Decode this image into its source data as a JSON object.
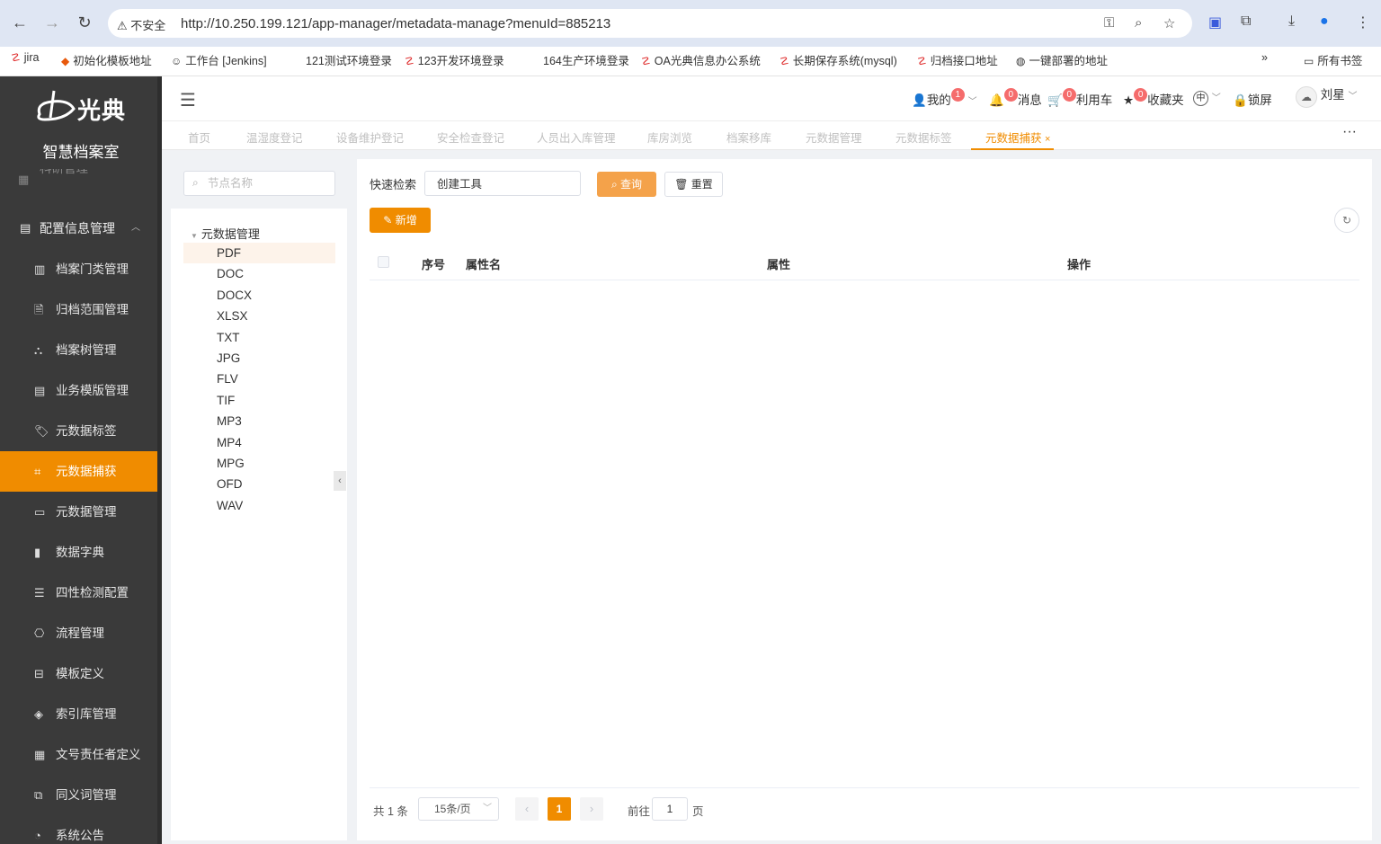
{
  "browser": {
    "not_secure": "不安全",
    "url": "http://10.250.199.121/app-manager/metadata-manage?menuId=885213",
    "bookmarks": [
      "jira",
      "初始化模板地址",
      "工作台 [Jenkins]",
      "121测试环境登录",
      "123开发环境登录",
      "164生产环境登录",
      "OA光典信息办公系统",
      "长期保存系统(mysql)",
      "归档接口地址",
      "一键部署的地址"
    ],
    "more": "»",
    "all_bookmarks": "所有书签"
  },
  "brand": {
    "logo_text": "光典",
    "title": "智慧档案室"
  },
  "sidebar": {
    "partial_item": "科研管理",
    "group": "配置信息管理",
    "items": [
      {
        "label": "档案门类管理",
        "icon": "bar-chart-icon"
      },
      {
        "label": "归档范围管理",
        "icon": "document-icon"
      },
      {
        "label": "档案树管理",
        "icon": "org-tree-icon"
      },
      {
        "label": "业务模版管理",
        "icon": "calendar-icon"
      },
      {
        "label": "元数据标签",
        "icon": "tag-icon"
      },
      {
        "label": "元数据捕获",
        "icon": "crop-icon"
      },
      {
        "label": "元数据管理",
        "icon": "card-icon"
      },
      {
        "label": "数据字典",
        "icon": "book-icon"
      },
      {
        "label": "四性检测配置",
        "icon": "sliders-icon"
      },
      {
        "label": "流程管理",
        "icon": "flow-icon"
      },
      {
        "label": "模板定义",
        "icon": "box-icon"
      },
      {
        "label": "索引库管理",
        "icon": "layers-icon"
      },
      {
        "label": "文号责任者定义",
        "icon": "grid-icon"
      },
      {
        "label": "同义词管理",
        "icon": "copy-icon"
      },
      {
        "label": "系统公告",
        "icon": "bell-icon"
      }
    ],
    "active_index": 5
  },
  "header": {
    "mine": "我的",
    "mine_badge": "1",
    "messages": "消息",
    "messages_badge": "0",
    "cart": "利用车",
    "cart_badge": "0",
    "favorites": "收藏夹",
    "favorites_badge": "0",
    "lang": "中",
    "lock": "锁屏",
    "user": "刘星"
  },
  "tabs": [
    "首页",
    "温湿度登记",
    "设备维护登记",
    "安全检查登记",
    "人员出入库管理",
    "库房浏览",
    "档案移库",
    "元数据管理",
    "元数据标签",
    "元数据捕获"
  ],
  "active_tab": "元数据捕获",
  "tree": {
    "search_placeholder": "节点名称",
    "root": "元数据管理",
    "nodes": [
      "PDF",
      "DOC",
      "DOCX",
      "XLSX",
      "TXT",
      "JPG",
      "FLV",
      "TIF",
      "MP3",
      "MP4",
      "MPG",
      "OFD",
      "WAV"
    ],
    "selected": "PDF"
  },
  "main": {
    "quick_search_label": "快速检索",
    "quick_search_value": "创建工具",
    "query_button": "查询",
    "reset_button": "重置",
    "add_button": "新增",
    "columns": [
      "序号",
      "属性名",
      "属性",
      "操作"
    ]
  },
  "pagination": {
    "total": "共 1 条",
    "page_size": "15条/页",
    "current_page": "1",
    "goto_label": "前往",
    "goto_value": "1",
    "page_suffix": "页"
  }
}
